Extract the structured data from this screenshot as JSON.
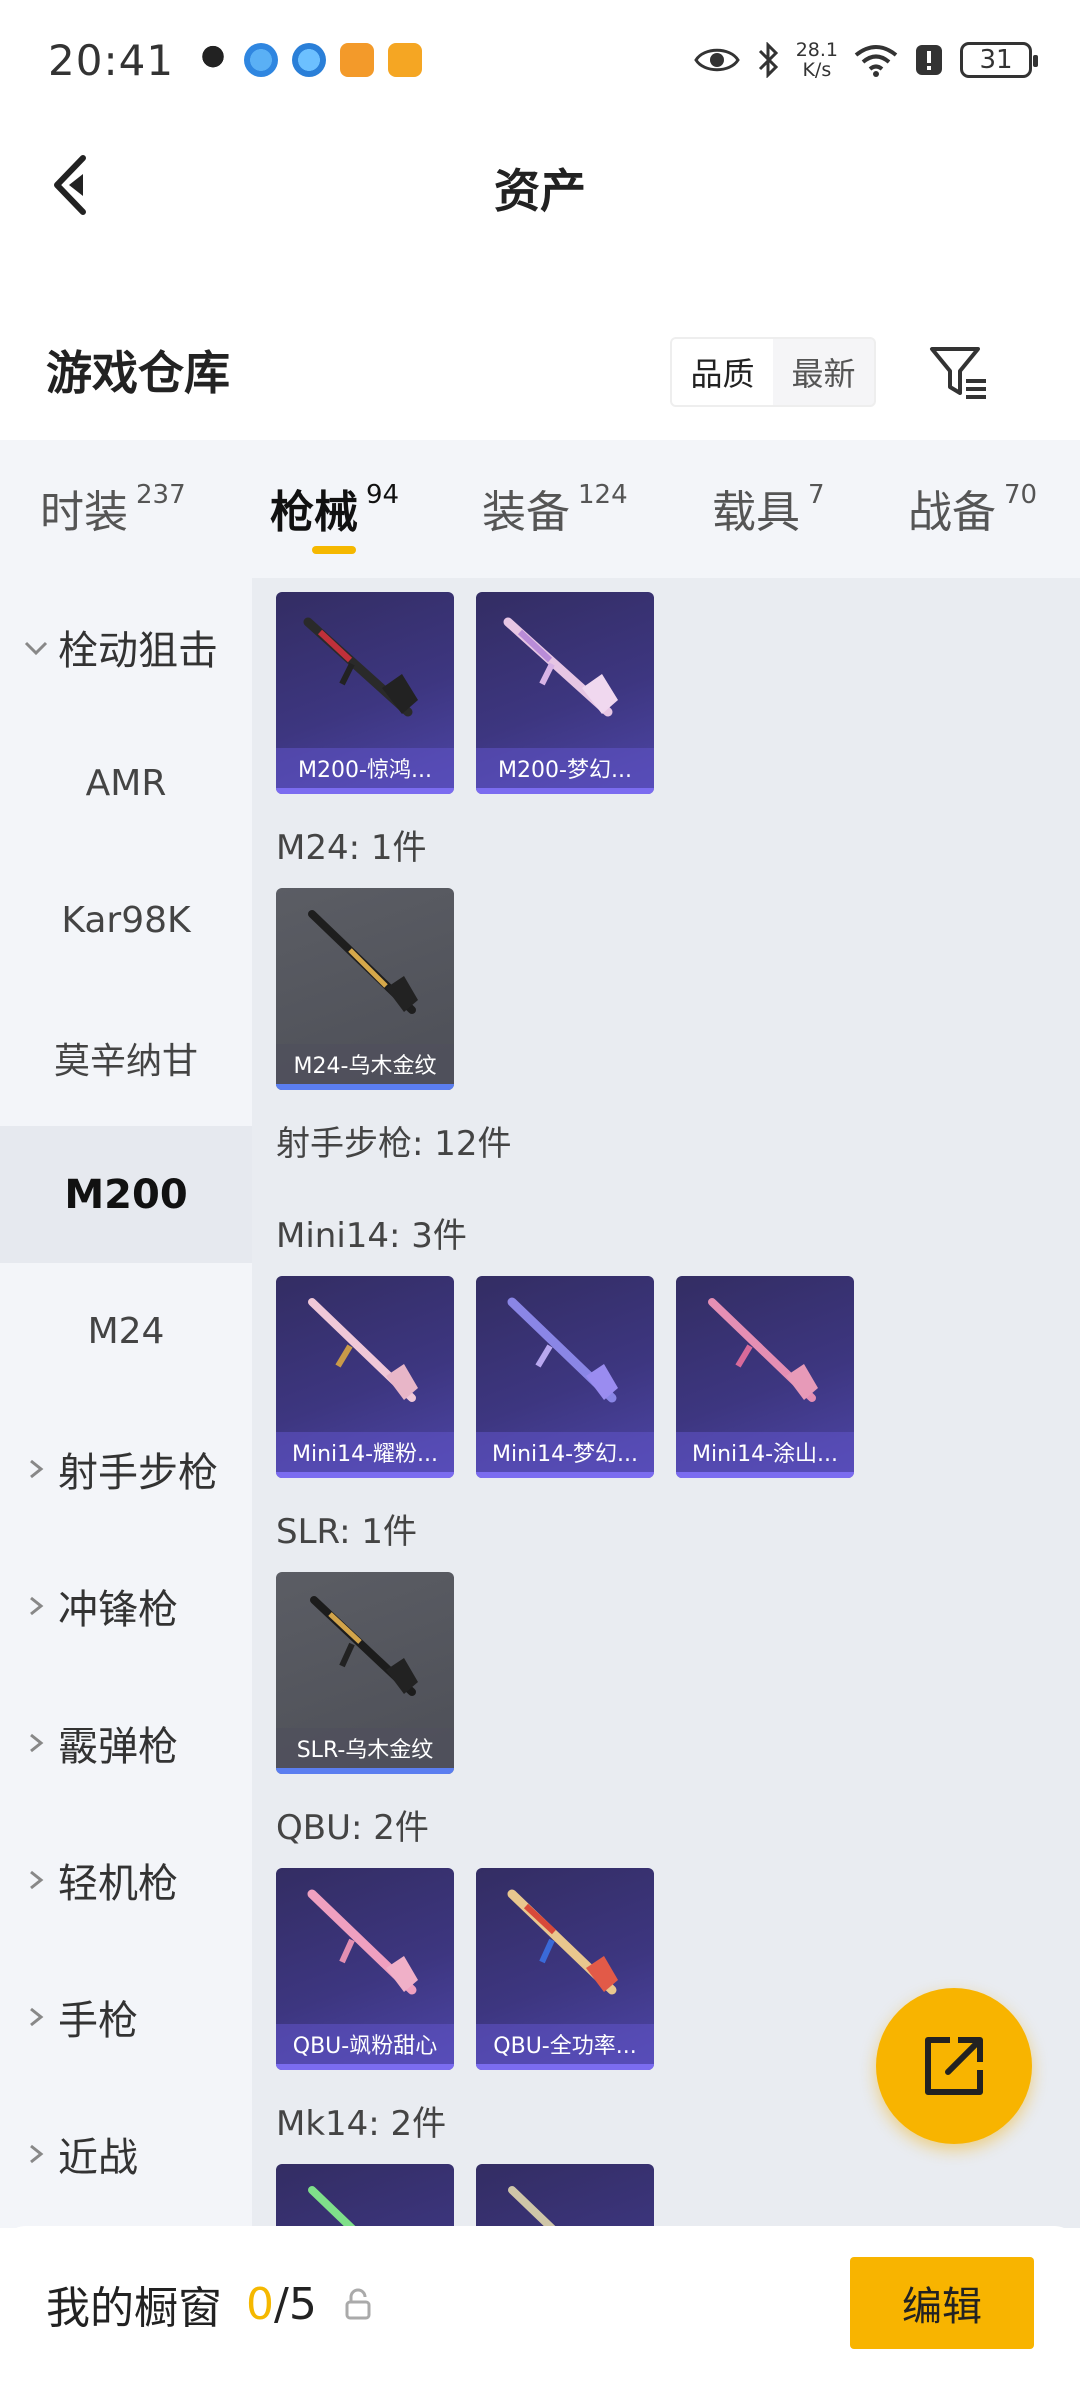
{
  "status_bar": {
    "time": "20:41",
    "net_speed_value": "28.1",
    "net_speed_unit": "K/s",
    "battery": "31",
    "app_icons": [
      "qq-icon",
      "browser-icon",
      "browser-icon-2",
      "game-icon",
      "video-icon"
    ]
  },
  "header": {
    "title": "资产"
  },
  "warehouse": {
    "title": "游戏仓库",
    "sort_options": [
      "品质",
      "最新"
    ],
    "active_sort": "品质"
  },
  "category_tabs": [
    {
      "label": "时装",
      "count": "237"
    },
    {
      "label": "枪械",
      "count": "94",
      "active": true
    },
    {
      "label": "装备",
      "count": "124"
    },
    {
      "label": "载具",
      "count": "7"
    },
    {
      "label": "战备",
      "count": "70"
    }
  ],
  "sidebar": [
    {
      "label": "栓动狙击",
      "type": "group-expanded"
    },
    {
      "label": "AMR"
    },
    {
      "label": "Kar98K"
    },
    {
      "label": "莫辛纳甘"
    },
    {
      "label": "M200",
      "active": true
    },
    {
      "label": "M24"
    },
    {
      "label": "射手步枪",
      "type": "group"
    },
    {
      "label": "冲锋枪",
      "type": "group"
    },
    {
      "label": "霰弹枪",
      "type": "group"
    },
    {
      "label": "轻机枪",
      "type": "group"
    },
    {
      "label": "手枪",
      "type": "group"
    },
    {
      "label": "近战",
      "type": "group"
    }
  ],
  "content": {
    "groups": [
      {
        "label": "",
        "items": [
          {
            "name": "M200-惊鸿...",
            "style": "purple"
          },
          {
            "name": "M200-梦幻...",
            "style": "purple"
          }
        ]
      },
      {
        "label": "M24: 1件",
        "items": [
          {
            "name": "M24-乌木金纹",
            "style": "gray"
          }
        ]
      },
      {
        "label": "射手步枪: 12件",
        "items": []
      },
      {
        "label": "Mini14: 3件",
        "items": [
          {
            "name": "Mini14-耀粉...",
            "style": "purple"
          },
          {
            "name": "Mini14-梦幻...",
            "style": "purple"
          },
          {
            "name": "Mini14-涂山...",
            "style": "purple"
          }
        ]
      },
      {
        "label": "SLR: 1件",
        "items": [
          {
            "name": "SLR-乌木金纹",
            "style": "gray"
          }
        ]
      },
      {
        "label": "QBU: 2件",
        "items": [
          {
            "name": "QBU-飒粉甜心",
            "style": "purple"
          },
          {
            "name": "QBU-全功率...",
            "style": "purple"
          }
        ]
      },
      {
        "label": "Mk14: 2件",
        "items": [
          {
            "name": "",
            "style": "purple"
          },
          {
            "name": "",
            "style": "purple"
          }
        ]
      }
    ]
  },
  "bottom_bar": {
    "showcase_label": "我的橱窗",
    "showcase_current": "0",
    "showcase_total": "/5",
    "edit_label": "编辑"
  },
  "colors": {
    "accent": "#f8b400",
    "card_purple": "#3d3680",
    "card_gray": "#54565e"
  }
}
